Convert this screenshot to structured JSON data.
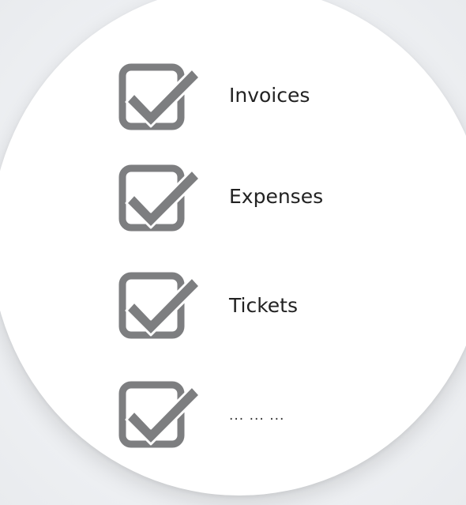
{
  "checklist": {
    "items": [
      {
        "label": "Invoices",
        "icon": "checkbox-checked-icon"
      },
      {
        "label": "Expenses",
        "icon": "checkbox-checked-icon"
      },
      {
        "label": "Tickets",
        "icon": "checkbox-checked-icon"
      },
      {
        "label": "... ... ...",
        "icon": "checkbox-checked-icon"
      }
    ]
  },
  "colors": {
    "icon_gray": "#7d7e80",
    "text": "#222222",
    "card": "#ffffff",
    "background": "#eef0f3"
  }
}
